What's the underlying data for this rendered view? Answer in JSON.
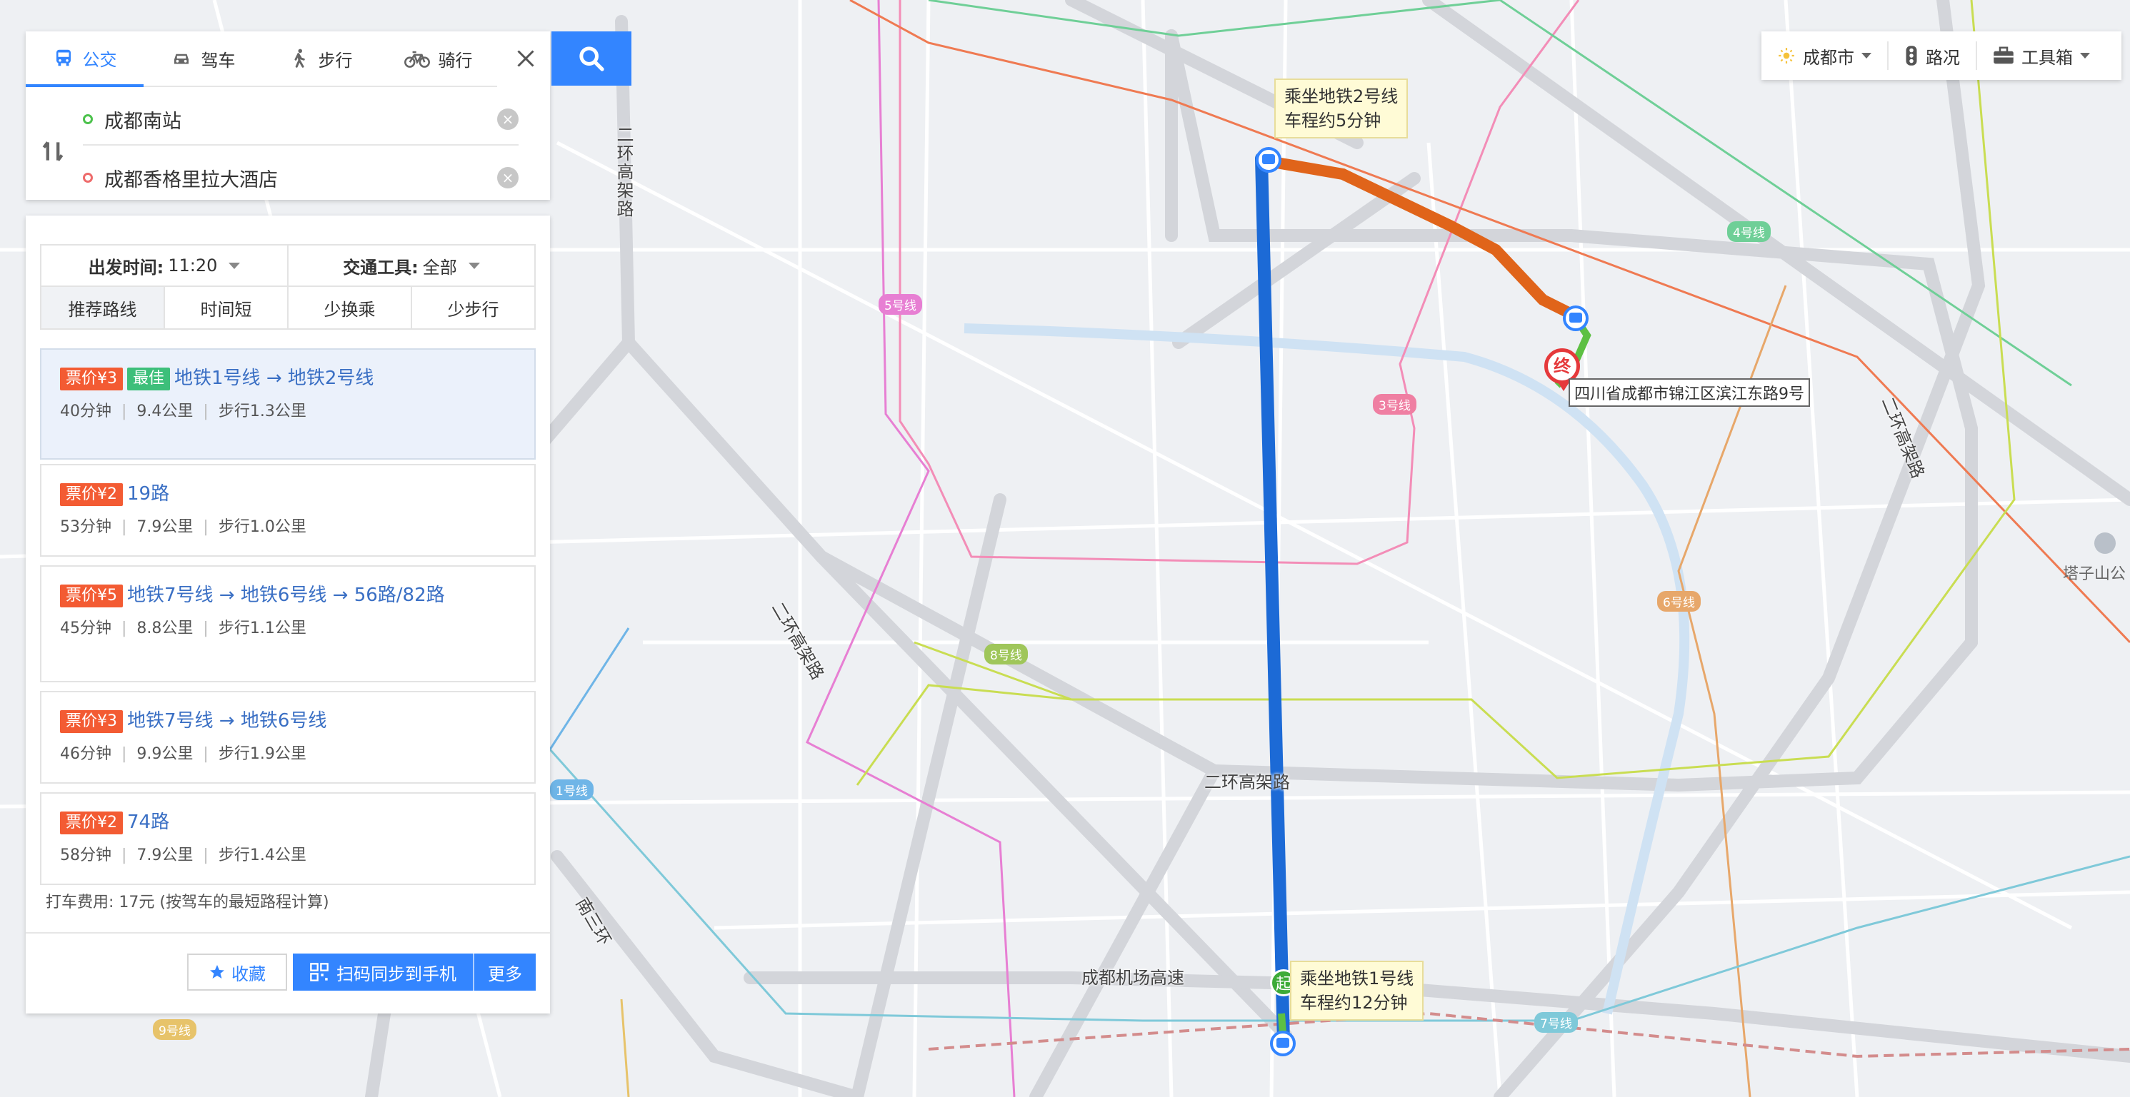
{
  "modes": [
    {
      "label": "公交",
      "icon": "bus-icon",
      "active": true
    },
    {
      "label": "驾车",
      "icon": "car-icon",
      "active": false
    },
    {
      "label": "步行",
      "icon": "walk-icon",
      "active": false
    },
    {
      "label": "骑行",
      "icon": "bike-icon",
      "active": false
    }
  ],
  "route": {
    "start": "成都南站",
    "end": "成都香格里拉大酒店"
  },
  "options": {
    "depart_label": "出发时间:",
    "depart_value": "11:20",
    "vehicle_label": "交通工具:",
    "vehicle_value": "全部",
    "prefs": [
      "推荐路线",
      "时间短",
      "少换乘",
      "少步行"
    ]
  },
  "plans": [
    {
      "fare": "票价¥3",
      "best": "最佳",
      "title": "地铁1号线 → 地铁2号线",
      "time": "40分钟",
      "distance": "9.4公里",
      "walk": "步行1.3公里"
    },
    {
      "fare": "票价¥2",
      "title": "19路",
      "time": "53分钟",
      "distance": "7.9公里",
      "walk": "步行1.0公里"
    },
    {
      "fare": "票价¥5",
      "title": "地铁7号线 → 地铁6号线 → 56路/82路",
      "time": "45分钟",
      "distance": "8.8公里",
      "walk": "步行1.1公里"
    },
    {
      "fare": "票价¥3",
      "title": "地铁7号线 → 地铁6号线",
      "time": "46分钟",
      "distance": "9.9公里",
      "walk": "步行1.9公里"
    },
    {
      "fare": "票价¥2",
      "title": "74路",
      "time": "58分钟",
      "distance": "7.9公里",
      "walk": "步行1.4公里"
    }
  ],
  "taxi": "打车费用: 17元 (按驾车的最短路程计算)",
  "buttons": {
    "favorite": "收藏",
    "sync": "扫码同步到手机",
    "more": "更多"
  },
  "toolbar": {
    "city": "成都市",
    "traffic": "路况",
    "toolbox": "工具箱"
  },
  "map": {
    "callout_line2_a": "乘坐地铁2号线",
    "callout_line2_b": "车程约5分钟",
    "callout_line1_a": "乘坐地铁1号线",
    "callout_line1_b": "车程约12分钟",
    "dest_address": "四川省成都市锦江区滨江东路9号",
    "start_marker": "起",
    "end_marker": "终",
    "road_ring2_elevated": "二环高架路",
    "road_airport_expressway": "成都机场高速",
    "road_ring2_west": "二环高架路",
    "road_ring2_sw": "二环高架路",
    "road_ring1_east": "二环高架路",
    "road_south3": "南三环",
    "poi_tazishan": "塔子山公",
    "metro_tags": [
      {
        "label": "5号线",
        "color": "#e77fd3"
      },
      {
        "label": "3号线",
        "color": "#ef7fa2"
      },
      {
        "label": "4号线",
        "color": "#6fcf97"
      },
      {
        "label": "6号线",
        "color": "#e7a76a"
      },
      {
        "label": "8号线",
        "color": "#9fc65a"
      },
      {
        "label": "7号线",
        "color": "#7fc9d9"
      },
      {
        "label": "9号线",
        "color": "#e7c36a"
      },
      {
        "label": "1号线",
        "color": "#6fb5e7"
      }
    ]
  }
}
